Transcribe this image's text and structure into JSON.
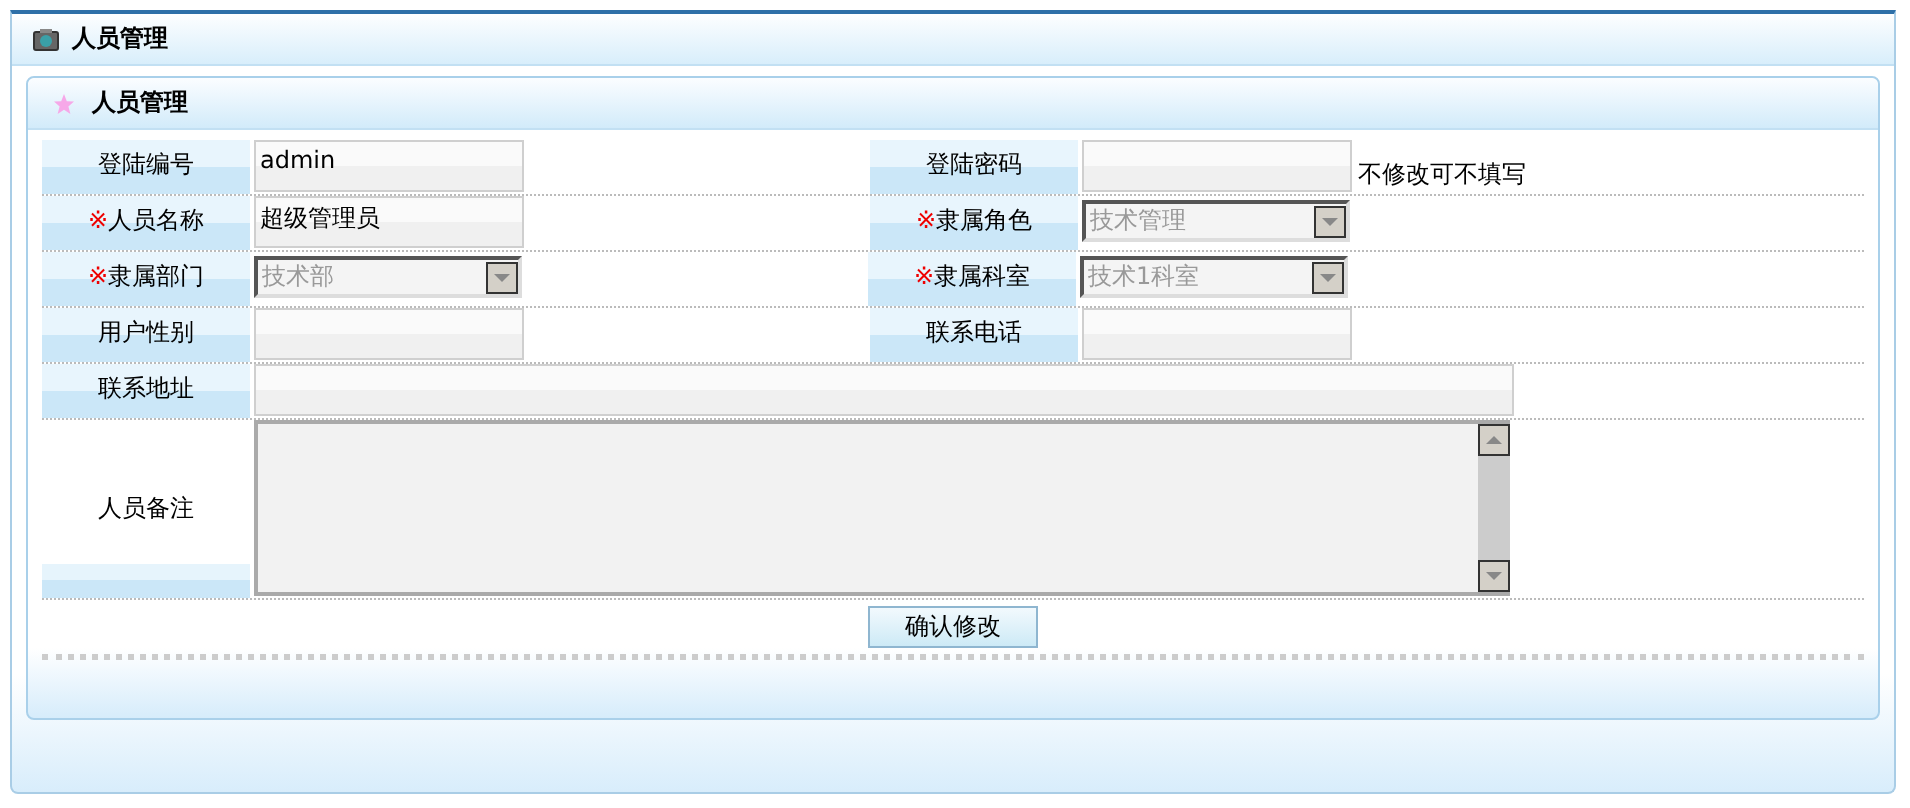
{
  "window": {
    "title": "人员管理"
  },
  "panel": {
    "title": "人员管理"
  },
  "rows": [
    {
      "cells": [
        {
          "label": "登陆编号",
          "kind": "text",
          "value": "admin"
        },
        {
          "label": "登陆密码",
          "kind": "text",
          "note": "不修改可不填写"
        }
      ]
    },
    {
      "cells": [
        {
          "label": "人员名称",
          "mark": "※",
          "kind": "text",
          "value": "超级管理员"
        },
        {
          "label": "隶属角色",
          "mark": "※",
          "kind": "select",
          "value": "技术管理"
        }
      ]
    },
    {
      "cells": [
        {
          "label": "隶属部门",
          "mark": "※",
          "kind": "select",
          "value": "技术部"
        },
        {
          "label": "隶属科室",
          "mark": "※",
          "kind": "select",
          "value": "技术1科室"
        }
      ]
    },
    {
      "cells": [
        {
          "label": "用户性别",
          "kind": "text"
        },
        {
          "label": "联系电话",
          "kind": "text"
        }
      ]
    }
  ],
  "address": {
    "label": "联系地址"
  },
  "remarks": {
    "label": "人员备注"
  },
  "submit": {
    "label": "确认修改"
  }
}
